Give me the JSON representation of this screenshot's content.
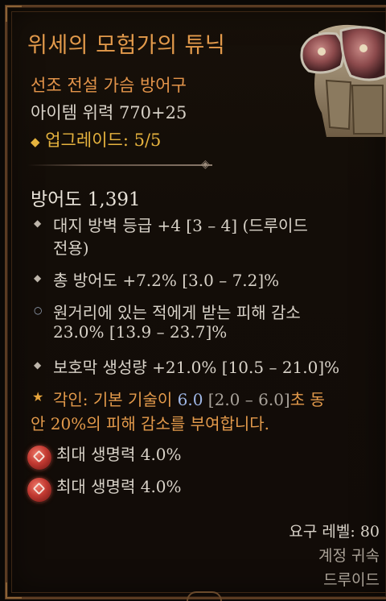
{
  "tooltip": {
    "item_name": "위세의 모험가의 튜닉",
    "item_type": "선조 전설 가슴 방어구",
    "item_power": "아이템 위력 770+25",
    "upgrade_icon": "diamond-icon",
    "upgrade": "업그레이드: 5/5",
    "armor": "방어도 1,391",
    "affixes": [
      {
        "line1": "대지 방벽 등급 +4 [3 – 4] (드루이드",
        "line2": "전용)"
      },
      {
        "line1": "총 방어도 +7.2% [3.0 – 7.2]%"
      },
      {
        "line1": "원거리에 있는 적에게 받는 피해 감소",
        "line2": "23.0% [13.9 – 23.7]%"
      },
      {
        "line1": "보호막 생성량 +21.0% [10.5 – 21.0]%"
      }
    ],
    "aspect": {
      "prefix": "각인: 기본 기술이 ",
      "value": "6.0",
      "range": " [2.0 – 6.0]",
      "suffix": "초 동",
      "line2": "안 20%의 피해 감소를 부여합니다."
    },
    "sockets": [
      {
        "icon": "ruby-gem-icon",
        "text": "최대 생명력 4.0%"
      },
      {
        "icon": "ruby-gem-icon",
        "text": "최대 생명력 4.0%"
      }
    ],
    "requirements": {
      "level": "요구 레벨: 80",
      "bound": "계정 귀속",
      "class": "드루이드"
    },
    "colors": {
      "legendary": "#e39a4b",
      "upgrade": "#e6b33e",
      "aspect_value": "#9fb7e6",
      "text": "#d8d2c8"
    }
  }
}
